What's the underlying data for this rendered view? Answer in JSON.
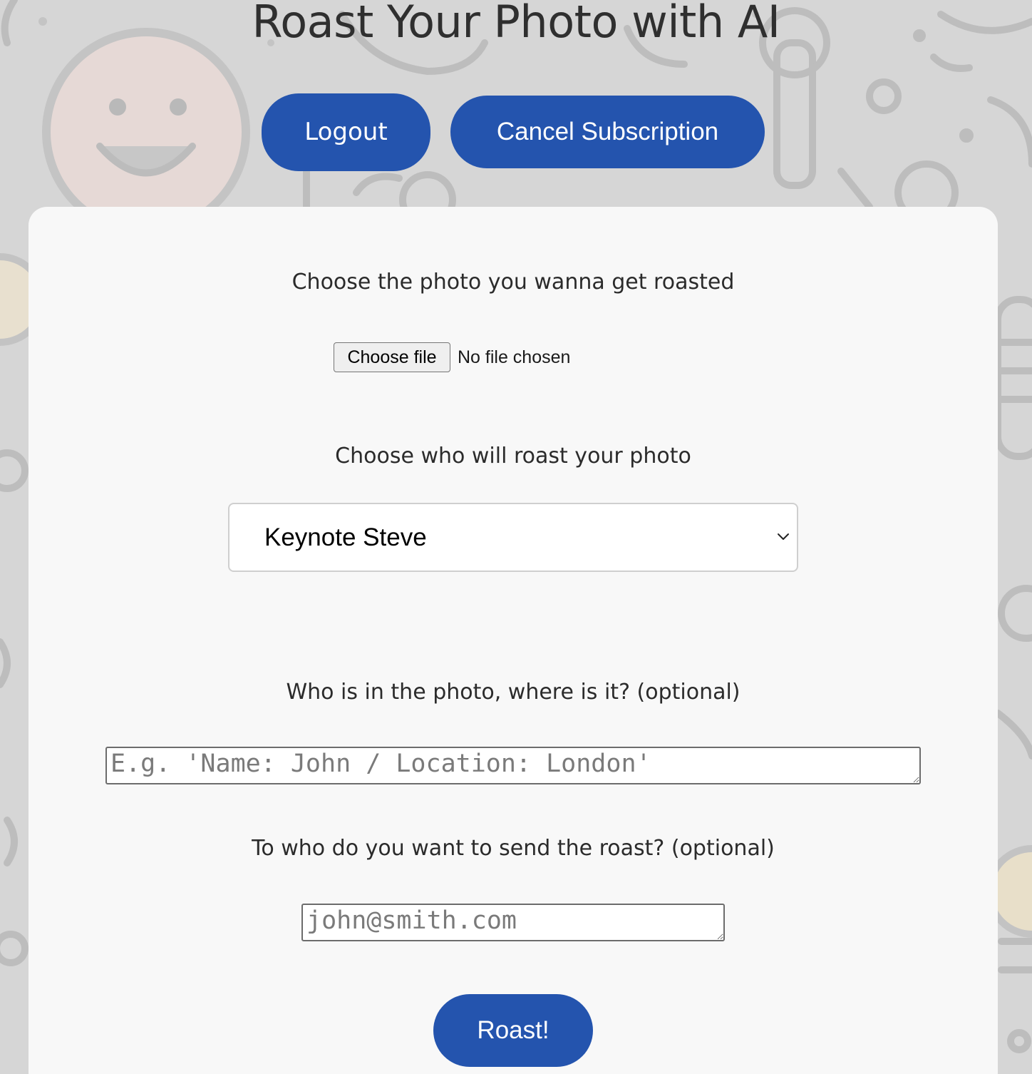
{
  "header": {
    "title": "Roast Your Photo with AI",
    "logout_label": "Logout",
    "cancel_subscription_label": "Cancel Subscription"
  },
  "form": {
    "photo_label": "Choose the photo you wanna get roasted",
    "choose_file_button": "Choose file",
    "file_status": "No file chosen",
    "roaster_label": "Choose who will roast your photo",
    "roaster_selected": "Keynote Steve",
    "context_label": "Who is in the photo, where is it? (optional)",
    "context_placeholder": "E.g. 'Name: John / Location: London'",
    "recipient_label": "To who do you want to send the roast? (optional)",
    "recipient_placeholder": "john@smith.com",
    "submit_label": "Roast!"
  },
  "icons": {
    "select_arrow": "chevron-down-icon",
    "background": "smiley-doodle-pattern"
  },
  "colors": {
    "button_blue": "#2454ae",
    "card_background": "#f8f8f8",
    "page_background": "#d6d6d6"
  }
}
